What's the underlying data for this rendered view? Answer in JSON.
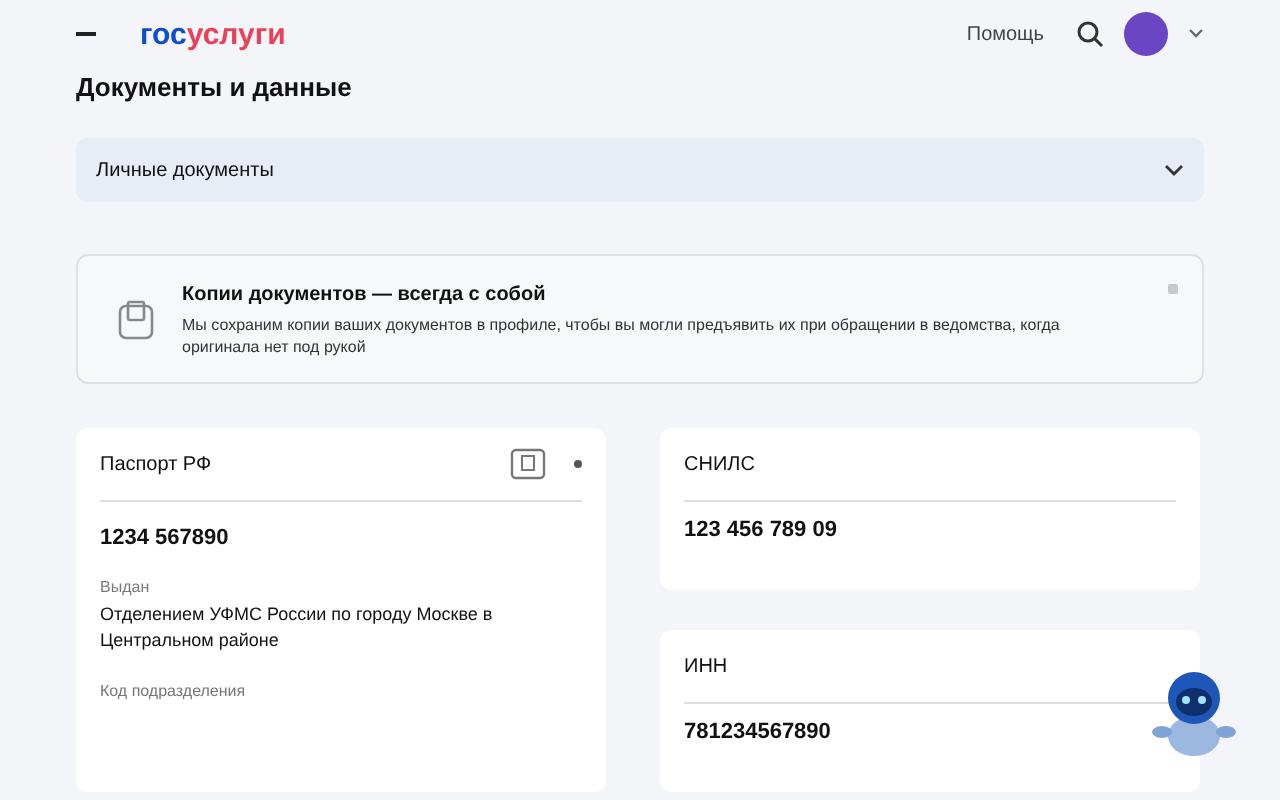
{
  "header": {
    "logo_prefix": "гос",
    "logo_suffix": "услуги",
    "help": "Помощь"
  },
  "page_title": "Документы и данные",
  "filter": {
    "value": "Личные документы"
  },
  "notice": {
    "title": "Копии документов — всегда с собой",
    "text": "Мы сохраним копии ваших документов в профиле, чтобы вы могли предъявить их при обращении в ведомства, когда оригинала нет под рукой"
  },
  "passport": {
    "title": "Паспорт РФ",
    "number": "1234 567890",
    "issued_label": "Выдан",
    "issued_value": "Отделением УФМС России по городу Москве в Центральном районе",
    "code_label": "Код подразделения"
  },
  "cards": [
    {
      "title": "СНИЛС",
      "value": "123 456 789 09"
    },
    {
      "title": "ИНН",
      "value": "781234567890"
    }
  ]
}
